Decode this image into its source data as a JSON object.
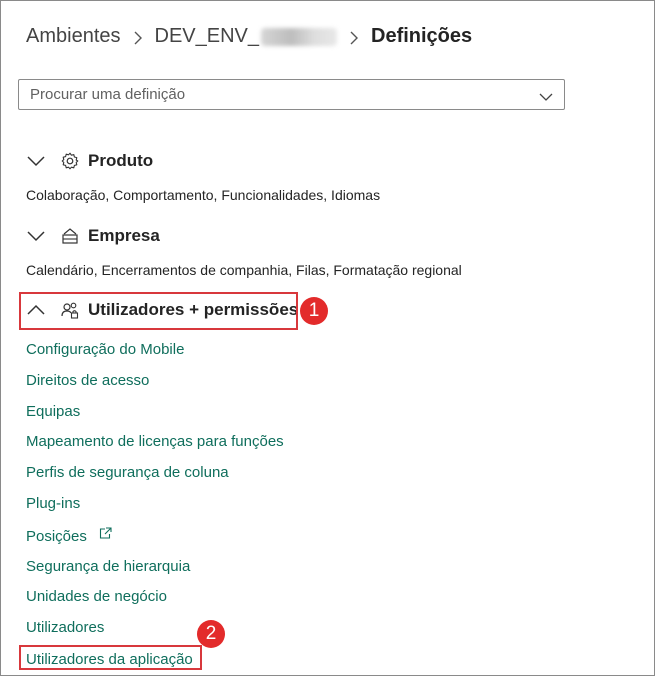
{
  "breadcrumb": {
    "root": "Ambientes",
    "environment": "DEV_ENV_",
    "current": "Definições"
  },
  "search": {
    "placeholder": "Procurar uma definição",
    "value": ""
  },
  "sections": [
    {
      "title": "Produto",
      "icon": "gear-icon",
      "expanded": false,
      "description": "Colaboração, Comportamento, Funcionalidades, Idiomas"
    },
    {
      "title": "Empresa",
      "icon": "building-icon",
      "expanded": false,
      "description": "Calendário, Encerramentos de companhia, Filas, Formatação regional"
    },
    {
      "title": "Utilizadores + permissões",
      "icon": "users-lock-icon",
      "expanded": true,
      "links": [
        "Configuração do Mobile",
        "Direitos de acesso",
        "Equipas",
        "Mapeamento de licenças para funções",
        "Perfis de segurança de coluna",
        "Plug-ins",
        "Posições",
        "Segurança de hierarquia",
        "Unidades de negócio",
        "Utilizadores",
        "Utilizadores da aplicação"
      ]
    }
  ],
  "annotations": {
    "step1": "1",
    "step2": "2",
    "color": "#e32b2b"
  },
  "colors": {
    "link": "#0f6e5c",
    "text": "#242424"
  }
}
